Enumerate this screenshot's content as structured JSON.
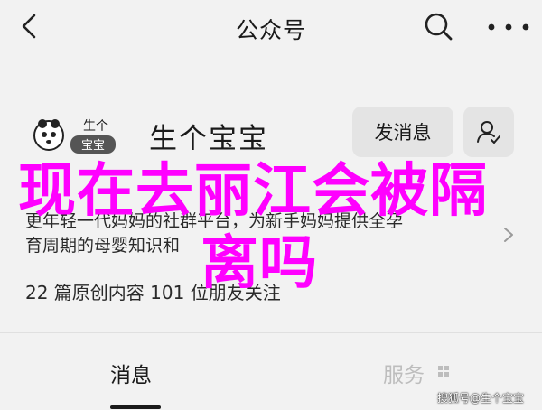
{
  "nav": {
    "title": "公众号"
  },
  "profile": {
    "name": "生个宝宝",
    "logo_text_top": "生个",
    "logo_text_bottom": "宝宝",
    "message_button": "发消息",
    "description_line1": "更年轻一代妈妈的社群平台，为新手妈妈提供全孕",
    "description_line2": "育周期的母婴知识和",
    "stats": "22 篇原创内容  101 位朋友关注"
  },
  "overlay": {
    "line1": "现在去丽江会被隔",
    "line2": "离吗",
    "color": "#ff00ff"
  },
  "tabs": {
    "messages": "消息",
    "services": "服务"
  },
  "watermark": "搜狐号@生个宝宝",
  "icons": {
    "back": "chevron-left-icon",
    "search": "search-icon",
    "more": "more-icon",
    "follow": "add-user-icon",
    "desc_more": "chevron-right-icon",
    "services_dropdown": "grid-icon"
  }
}
